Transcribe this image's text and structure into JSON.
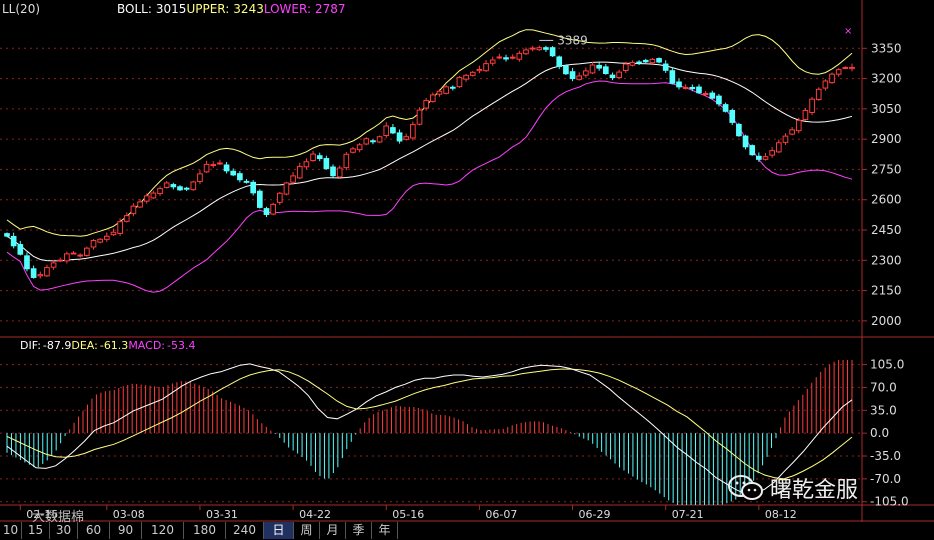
{
  "indicator_label": "LL(20)",
  "boll": {
    "label": "BOLL:",
    "mid": "3015",
    "upper_label": "UPPER:",
    "upper": "3243",
    "lower_label": "LOWER:",
    "lower": "2787"
  },
  "macd_header": {
    "dif_label": "DIF:",
    "dif": "-87.9",
    "dea_label": "DEA:",
    "dea": "-61.3",
    "macd_label": "MACD:",
    "macd": "-53.4"
  },
  "peak_label": "3389",
  "price_ticks": [
    "3350",
    "3200",
    "3050",
    "2900",
    "2750",
    "2600",
    "2450",
    "2300",
    "2150",
    "2000"
  ],
  "macd_ticks": [
    "105.0",
    "70.0",
    "35.0",
    "0.0",
    "-35.0",
    "-70.0",
    "-105.0"
  ],
  "date_labels": [
    "02-15",
    "03-08",
    "03-31",
    "04-22",
    "05-16",
    "06-07",
    "06-29",
    "07-21",
    "08-12"
  ],
  "period_tabs": [
    "10",
    "15",
    "30",
    "60",
    "90",
    "120",
    "180",
    "240",
    "日",
    "周",
    "月",
    "季",
    "年"
  ],
  "active_tab": "日",
  "watermark": {
    "brand": "曙乾金服",
    "site_text": "大数据棉"
  },
  "colors": {
    "up": "#ff3c3c",
    "down": "#54ffff",
    "mid": "#ffffff",
    "upper": "#ffff80",
    "lower": "#ff40ff",
    "grid": "#8a2222",
    "dif": "#ffffff",
    "dea": "#ffff80",
    "axis": "#aa2a2a"
  },
  "chart_data": [
    {
      "type": "candlestick",
      "series_names": [
        "BOLL",
        "UPPER",
        "LOWER"
      ],
      "y_ticks": [
        3350,
        3200,
        3050,
        2900,
        2750,
        2600,
        2450,
        2300,
        2150,
        2000
      ],
      "ylim": [
        1930,
        3500
      ],
      "x_date_labels": [
        "02-15",
        "03-08",
        "03-31",
        "04-22",
        "05-16",
        "06-07",
        "06-29",
        "07-21",
        "08-12"
      ],
      "annotation": {
        "label": "3389",
        "value": 3389
      },
      "close": [
        2420,
        2372,
        2330,
        2258,
        2215,
        2229,
        2264,
        2287,
        2301,
        2332,
        2336,
        2326,
        2360,
        2398,
        2404,
        2419,
        2439,
        2491,
        2521,
        2568,
        2589,
        2619,
        2633,
        2655,
        2683,
        2664,
        2649,
        2656,
        2688,
        2728,
        2775,
        2774,
        2782,
        2743,
        2723,
        2699,
        2686,
        2634,
        2562,
        2527,
        2577,
        2632,
        2683,
        2718,
        2765,
        2788,
        2826,
        2804,
        2754,
        2719,
        2757,
        2825,
        2852,
        2872,
        2902,
        2888,
        2912,
        2965,
        2931,
        2891,
        2912,
        2972,
        3044,
        3091,
        3119,
        3137,
        3159,
        3154,
        3205,
        3216,
        3231,
        3245,
        3274,
        3292,
        3307,
        3297,
        3306,
        3325,
        3342,
        3351,
        3353,
        3345,
        3313,
        3260,
        3224,
        3200,
        3213,
        3238,
        3267,
        3252,
        3225,
        3205,
        3232,
        3272,
        3280,
        3280,
        3283,
        3295,
        3282,
        3241,
        3177,
        3159,
        3156,
        3150,
        3130,
        3126,
        3103,
        3075,
        3038,
        2983,
        2917,
        2862,
        2823,
        2800,
        2813,
        2843,
        2882,
        2915,
        2946,
        2993,
        3042,
        3098,
        3147,
        3188,
        3222,
        3244,
        3255,
        3255
      ]
    },
    {
      "type": "macd",
      "series_names": [
        "DIF",
        "DEA",
        "MACD"
      ],
      "y_ticks": [
        105,
        70,
        35,
        0,
        -35,
        -70,
        -105
      ],
      "ylim": [
        -110,
        112
      ],
      "dif": [
        -20,
        -31,
        -42,
        -53,
        -54,
        -50,
        -39,
        -26,
        -12,
        4,
        11,
        16,
        25,
        34,
        40,
        46,
        52,
        62,
        72,
        80,
        86,
        91,
        94,
        99,
        104,
        106,
        102,
        99,
        94,
        83,
        72,
        58,
        38,
        24,
        22,
        29,
        37,
        48,
        57,
        63,
        70,
        75,
        81,
        84,
        84,
        87,
        89,
        89,
        87,
        86,
        88,
        90,
        94,
        99,
        102,
        104,
        103,
        102,
        99,
        94,
        89,
        79,
        68,
        55,
        43,
        31,
        19,
        6,
        -8,
        -22,
        -33,
        -45,
        -55,
        -68,
        -77,
        -86,
        -93,
        -92,
        -86,
        -75,
        -59,
        -44,
        -28,
        -10,
        8,
        24,
        40,
        51
      ],
      "dea": [
        -5,
        -12,
        -19,
        -26,
        -32,
        -36,
        -37,
        -35,
        -31,
        -25,
        -21,
        -17,
        -11,
        -4,
        3,
        10,
        17,
        24,
        32,
        41,
        50,
        58,
        67,
        75,
        83,
        89,
        93,
        96,
        97,
        94,
        88,
        80,
        70,
        60,
        49,
        41,
        37,
        38,
        41,
        45,
        49,
        55,
        61,
        66,
        70,
        73,
        77,
        80,
        83,
        84,
        85,
        87,
        88,
        91,
        93,
        95,
        97,
        98,
        98,
        97,
        95,
        92,
        87,
        81,
        74,
        67,
        59,
        51,
        43,
        33,
        25,
        13,
        1,
        -12,
        -23,
        -35,
        -47,
        -57,
        -64,
        -68,
        -70,
        -65,
        -58,
        -50,
        -41,
        -30,
        -18,
        -6
      ]
    }
  ]
}
